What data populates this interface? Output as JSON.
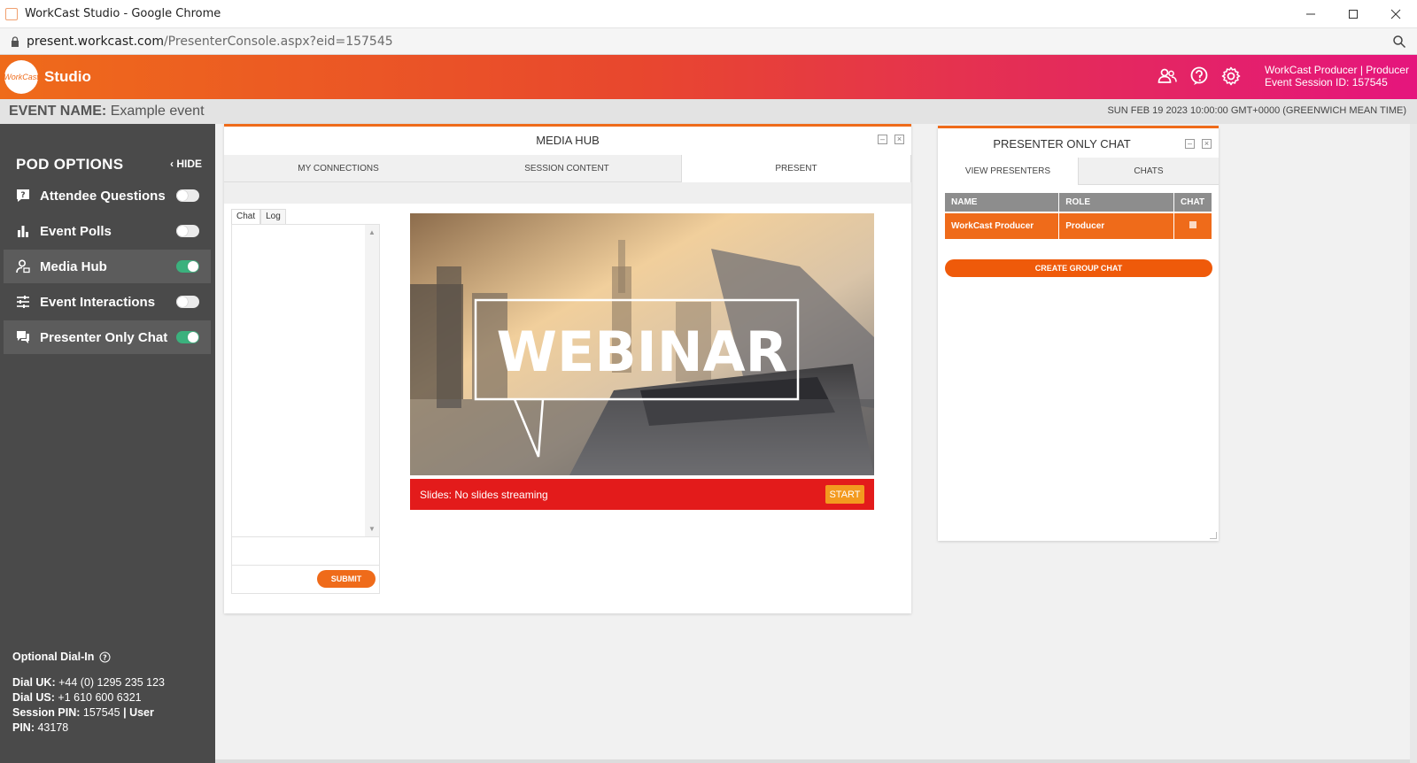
{
  "browser": {
    "window_title": "WorkCast Studio - Google Chrome",
    "url_host": "present.workcast.com",
    "url_path": "/PresenterConsole.aspx?eid=157545"
  },
  "header": {
    "logo_text": "WorkCast",
    "app_title": "Studio",
    "user_line1": "WorkCast Producer | Producer",
    "user_line2": "Event Session ID: 157545",
    "icons": [
      "people-icon",
      "help-icon",
      "gear-icon"
    ]
  },
  "event": {
    "label": "EVENT NAME:",
    "name": "Example event",
    "datetime": "SUN FEB 19 2023 10:00:00 GMT+0000 (GREENWICH MEAN TIME)"
  },
  "sidebar": {
    "title": "POD OPTIONS",
    "hide_label": "‹ HIDE",
    "items": [
      {
        "label": "Attendee Questions",
        "icon": "question-bubble-icon",
        "enabled": false
      },
      {
        "label": "Event Polls",
        "icon": "bar-chart-icon",
        "enabled": false
      },
      {
        "label": "Media Hub",
        "icon": "user-media-icon",
        "enabled": true
      },
      {
        "label": "Event Interactions",
        "icon": "sliders-icon",
        "enabled": false
      },
      {
        "label": "Presenter Only Chat",
        "icon": "chat-bubbles-icon",
        "enabled": true
      }
    ],
    "dial": {
      "title": "Optional Dial-In",
      "uk_label": "Dial UK:",
      "uk_number": "+44 (0) 1295 235 123",
      "us_label": "Dial US:",
      "us_number": "+1 610 600 6321",
      "session_pin_label": "Session PIN:",
      "session_pin": "157545",
      "user_label": "| User",
      "user_pin_label": "PIN:",
      "user_pin": "43178"
    }
  },
  "media_hub": {
    "title": "MEDIA HUB",
    "tabs": [
      "MY CONNECTIONS",
      "SESSION CONTENT",
      "PRESENT"
    ],
    "active_tab": "PRESENT",
    "chat_tabs": [
      "Chat",
      "Log"
    ],
    "submit_label": "SUBMIT",
    "slide_text": "WEBINAR",
    "status_text": "Slides: No slides streaming",
    "start_label": "START"
  },
  "presenter_chat": {
    "title": "PRESENTER ONLY CHAT",
    "tabs": [
      "VIEW PRESENTERS",
      "CHATS"
    ],
    "columns": [
      "NAME",
      "ROLE",
      "CHAT"
    ],
    "rows": [
      {
        "name": "WorkCast Producer",
        "role": "Producer"
      }
    ],
    "group_button": "CREATE GROUP CHAT"
  },
  "colors": {
    "accent": "#ef6b1a",
    "sidebar_bg": "#4a4a4a",
    "toggle_on": "#3bb17d",
    "status_red": "#e31b1b",
    "start_orange": "#f39a1f"
  }
}
